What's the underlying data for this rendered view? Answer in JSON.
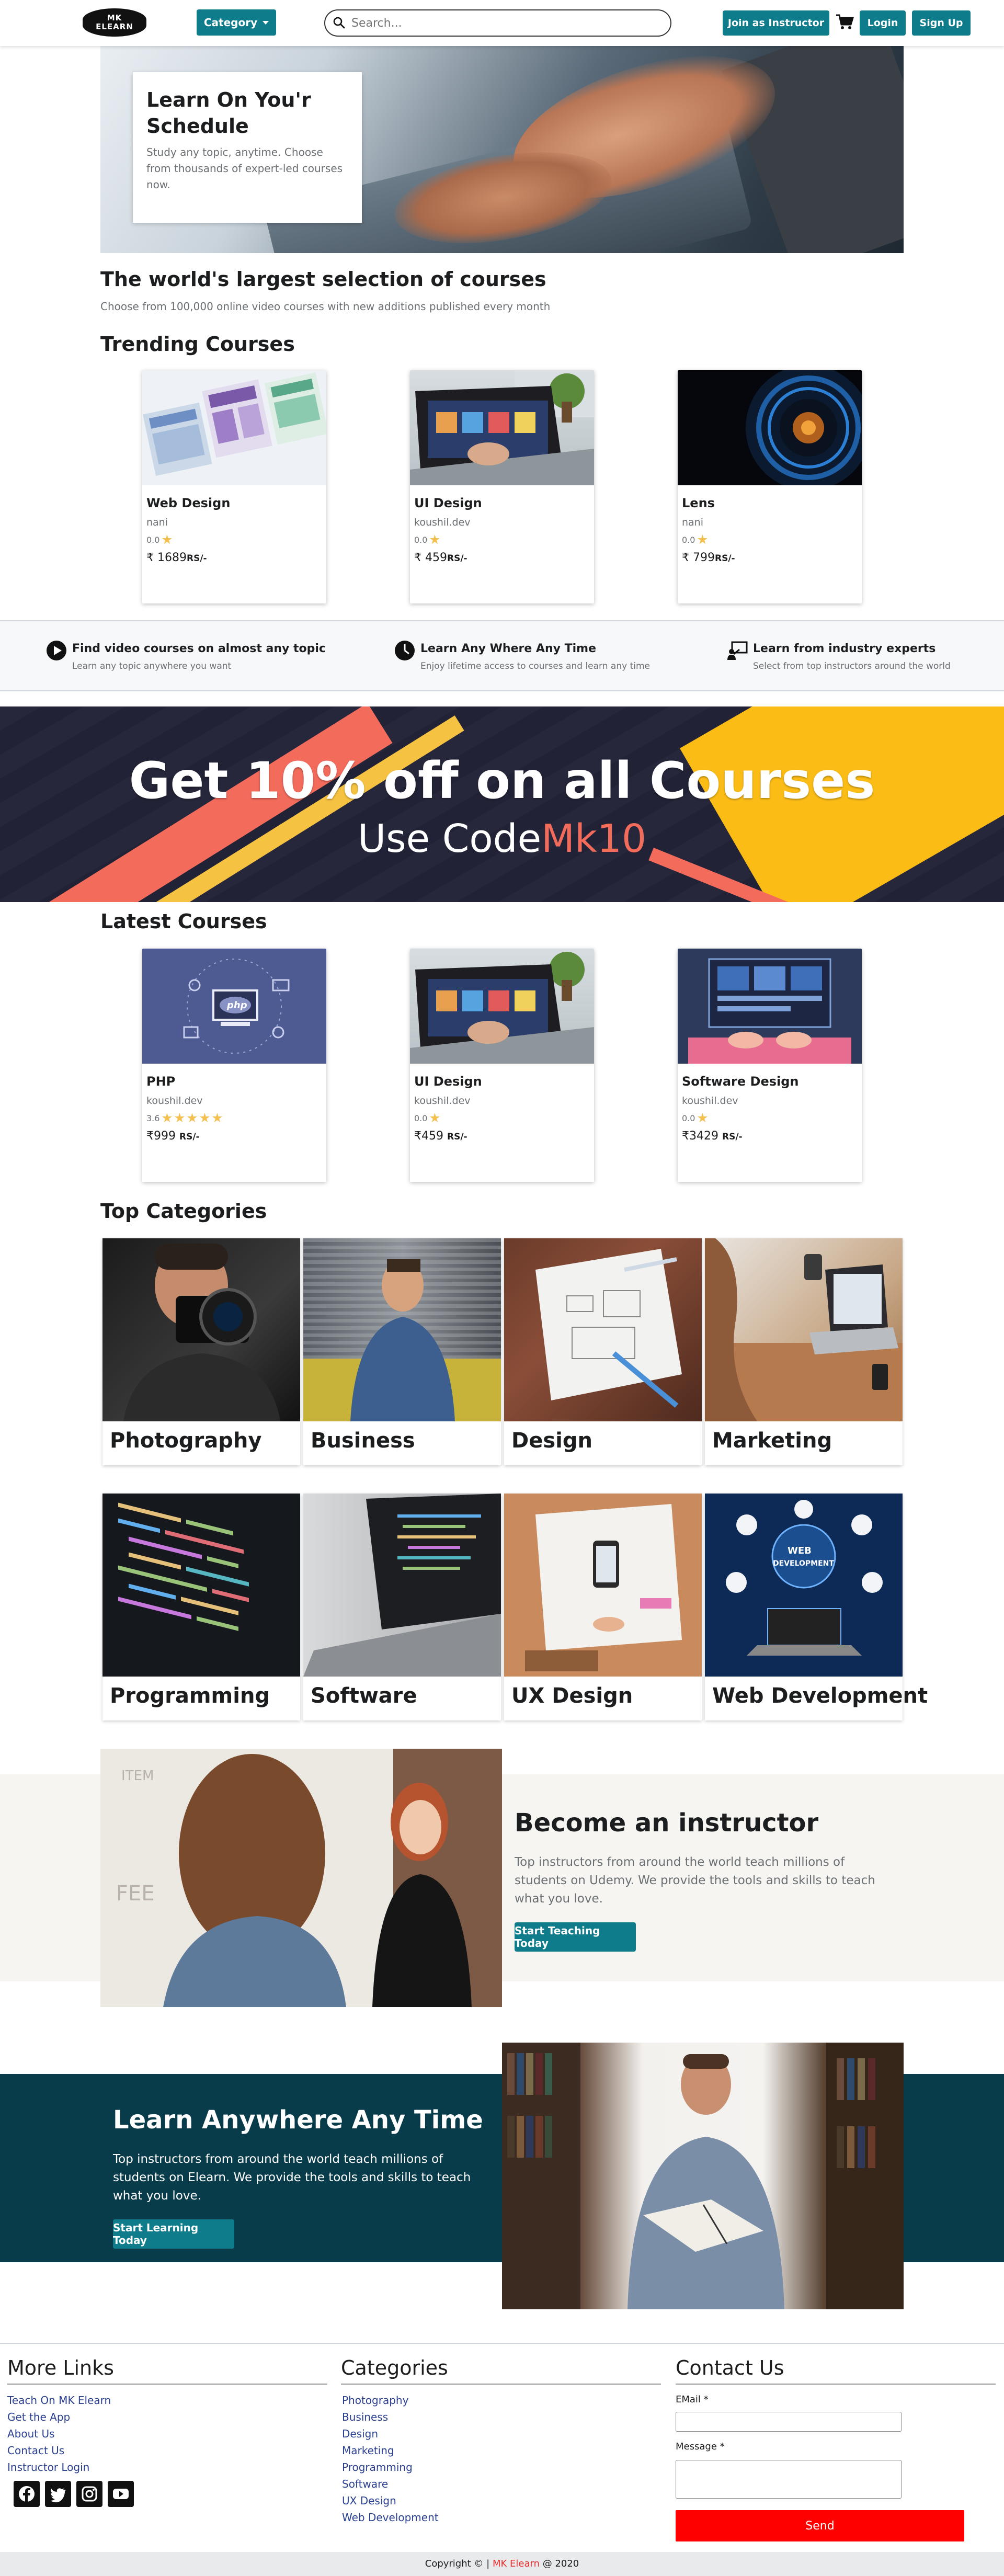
{
  "nav": {
    "logo_line1": "MK",
    "logo_line2": "ELEARN",
    "category_label": "Category",
    "search_placeholder": "Search...",
    "instructor_label": "Join as Instructor",
    "login_label": "Login",
    "signup_label": "Sign Up",
    "accent": "#0f7c8c"
  },
  "hero": {
    "title": "Learn On You'r Schedule",
    "text": "Study any topic, anytime. Choose from thousands of expert-led courses now."
  },
  "selection": {
    "title": "The world's largest selection of courses",
    "subtitle": "Choose from 100,000 online video courses with new additions published every month"
  },
  "trending": {
    "title": "Trending Courses",
    "courses": [
      {
        "title": "Web Design",
        "author": "nani",
        "rating": "0.0",
        "price": "₹ 1689",
        "unit": "RS/-",
        "stars": 1
      },
      {
        "title": "UI Design",
        "author": "koushil.dev",
        "rating": "0.0",
        "price": "₹ 459",
        "unit": "RS/-",
        "stars": 1
      },
      {
        "title": "Lens",
        "author": "nani",
        "rating": "0.0",
        "price": "₹ 799",
        "unit": "RS/-",
        "stars": 1
      }
    ]
  },
  "features": [
    {
      "title": "Find video courses on almost any topic",
      "text": "Learn any topic anywhere you want",
      "icon": "play-circle-icon"
    },
    {
      "title": "Learn Any Where Any Time",
      "text": "Enjoy lifetime access to courses and learn any time",
      "icon": "clock-icon"
    },
    {
      "title": "Learn from industry experts",
      "text": "Select from top instructors around the world",
      "icon": "teacher-board-icon"
    }
  ],
  "promo": {
    "headline": "Get 10% off on all Courses",
    "use_code": "Use Code",
    "code": "Mk10"
  },
  "latest": {
    "title": "Latest Courses",
    "courses": [
      {
        "title": "PHP",
        "author": "koushil.dev",
        "rating": "3.6",
        "price": "₹999",
        "unit": "RS/-",
        "stars": 5
      },
      {
        "title": "UI Design",
        "author": "koushil.dev",
        "rating": "0.0",
        "price": "₹459",
        "unit": "RS/-",
        "stars": 1
      },
      {
        "title": "Software Design",
        "author": "koushil.dev",
        "rating": "0.0",
        "price": "₹3429",
        "unit": "RS/-",
        "stars": 1
      }
    ]
  },
  "categories": {
    "title": "Top Categories",
    "items": [
      "Photography",
      "Business",
      "Design",
      "Marketing",
      "Programming",
      "Software",
      "UX Design",
      "Web Development"
    ]
  },
  "instructor": {
    "title": "Become an instructor",
    "text": "Top instructors from around the world teach millions of students on Udemy. We provide the tools and skills to teach what you love.",
    "button": "Start Teaching Today"
  },
  "learn": {
    "title": "Learn Anywhere Any Time",
    "text": "Top instructors from around the world teach millions of students on Elearn. We provide the tools and skills to teach what you love.",
    "button": "Start Learning Today"
  },
  "footer": {
    "more_links_title": "More Links",
    "more_links": [
      "Teach On MK Elearn",
      "Get the App",
      "About Us",
      "Contact Us",
      "Instructor Login"
    ],
    "categories_title": "Categories",
    "categories": [
      "Photography",
      "Business",
      "Design",
      "Marketing",
      "Programming",
      "Software",
      "UX Design",
      "Web Development"
    ],
    "contact_title": "Contact Us",
    "email_label": "EMail *",
    "message_label": "Message *",
    "send_label": "Send",
    "social_icons": [
      "facebook-icon",
      "twitter-icon",
      "instagram-icon",
      "youtube-icon"
    ],
    "copyright_prefix": "Copyright © |",
    "copyright_brand": "MK Elearn",
    "copyright_suffix": "@ 2020"
  }
}
